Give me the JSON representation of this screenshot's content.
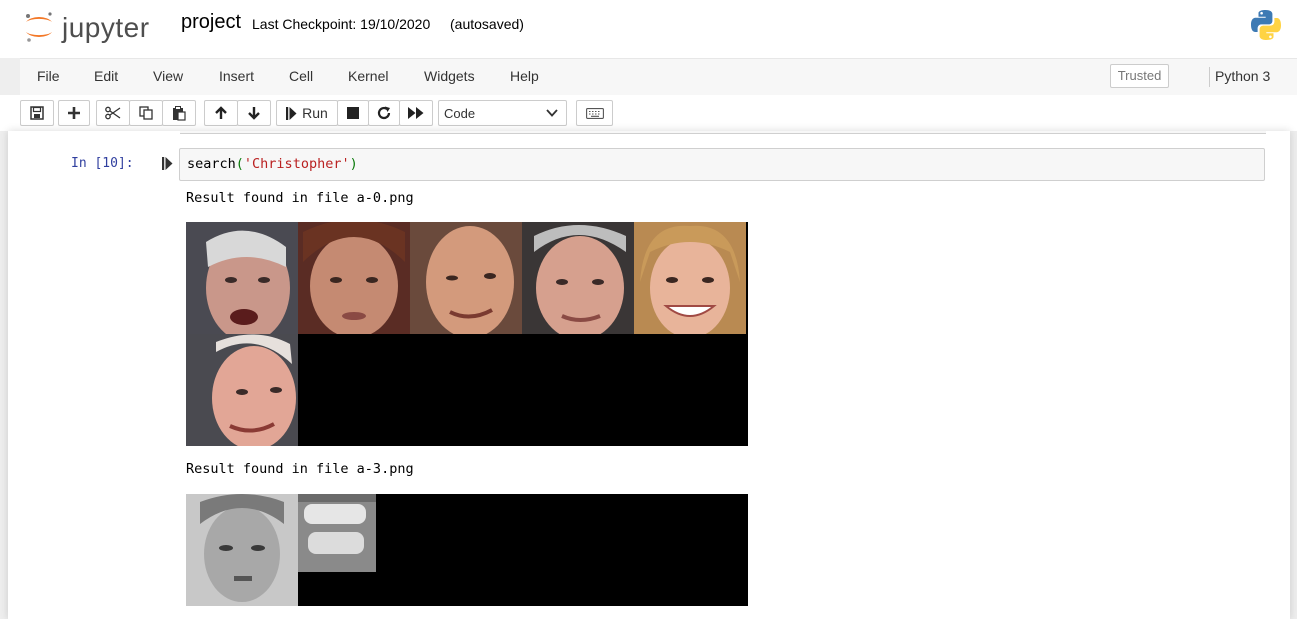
{
  "header": {
    "logo_text": "jupyter",
    "notebook_name": "project",
    "checkpoint": "Last Checkpoint: 19/10/2020",
    "autosave_status": "(autosaved)",
    "kernel_logo": "python-logo-icon"
  },
  "menubar": {
    "items": [
      "File",
      "Edit",
      "View",
      "Insert",
      "Cell",
      "Kernel",
      "Widgets",
      "Help"
    ],
    "trusted": "Trusted",
    "kernel_name": "Python 3"
  },
  "toolbar": {
    "buttons": [
      "save-icon",
      "plus-icon",
      "cut-icon",
      "copy-icon",
      "paste-icon",
      "arrow-up-icon",
      "arrow-down-icon",
      "run-icon",
      "stop-icon",
      "restart-icon",
      "fast-forward-icon",
      "keyboard-icon"
    ],
    "run_label": "Run",
    "cell_type": "Code"
  },
  "cell": {
    "prompt": "In [10]:",
    "code_fn": "search",
    "code_open": "(",
    "code_arg": "'Christopher'",
    "code_close": ")",
    "outputs": [
      {
        "text": "Result found in file a-0.png",
        "image": "face-grid-6-faces"
      },
      {
        "text": "Result found in file a-3.png",
        "image": "face-grid-2-grayscale"
      }
    ]
  },
  "colors": {
    "prompt": "#303f9f",
    "string": "#ba2121",
    "paren": "#0b7a0b",
    "jupyter_orange": "#f37726"
  }
}
